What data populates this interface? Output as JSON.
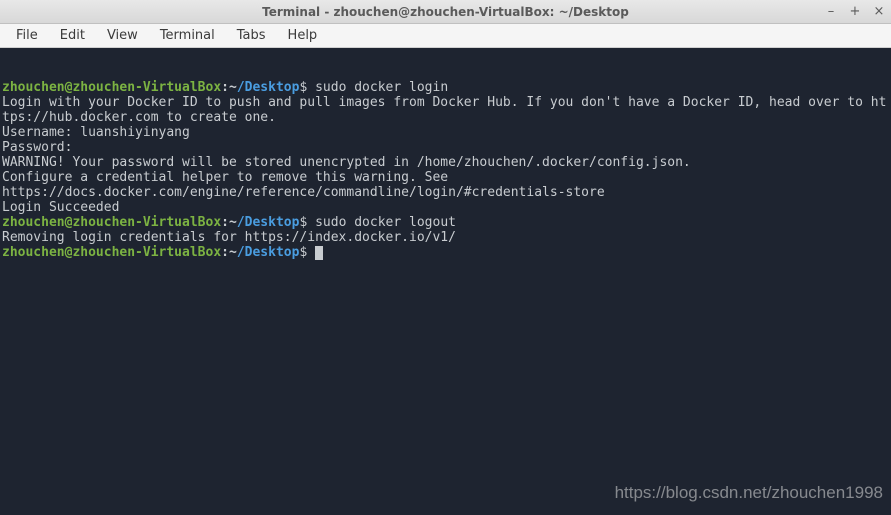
{
  "window": {
    "title": "Terminal - zhouchen@zhouchen-VirtualBox: ~/Desktop",
    "controls": {
      "minimize": "–",
      "maximize": "+",
      "close": "×"
    }
  },
  "menubar": {
    "items": [
      "File",
      "Edit",
      "View",
      "Terminal",
      "Tabs",
      "Help"
    ]
  },
  "terminal": {
    "prompt": {
      "userhost": "zhouchen@zhouchen-VirtualBox",
      "sep": ":",
      "tilde": "~",
      "slash": "/",
      "dir": "Desktop",
      "dollar": "$"
    },
    "blocks": [
      {
        "type": "prompt_cmd",
        "cmd": "sudo docker login"
      },
      {
        "type": "out",
        "text": "Login with your Docker ID to push and pull images from Docker Hub. If you don't have a Docker ID, head over to https://hub.docker.com to create one."
      },
      {
        "type": "out",
        "text": "Username: luanshiyinyang"
      },
      {
        "type": "out",
        "text": "Password: "
      },
      {
        "type": "out",
        "text": "WARNING! Your password will be stored unencrypted in /home/zhouchen/.docker/config.json."
      },
      {
        "type": "out",
        "text": "Configure a credential helper to remove this warning. See"
      },
      {
        "type": "out",
        "text": "https://docs.docker.com/engine/reference/commandline/login/#credentials-store"
      },
      {
        "type": "out",
        "text": ""
      },
      {
        "type": "out",
        "text": "Login Succeeded"
      },
      {
        "type": "prompt_cmd",
        "cmd": "sudo docker logout"
      },
      {
        "type": "out",
        "text": "Removing login credentials for https://index.docker.io/v1/"
      },
      {
        "type": "prompt_cmd",
        "cmd": "",
        "cursor": true
      }
    ]
  },
  "watermark": "https://blog.csdn.net/zhouchen1998"
}
